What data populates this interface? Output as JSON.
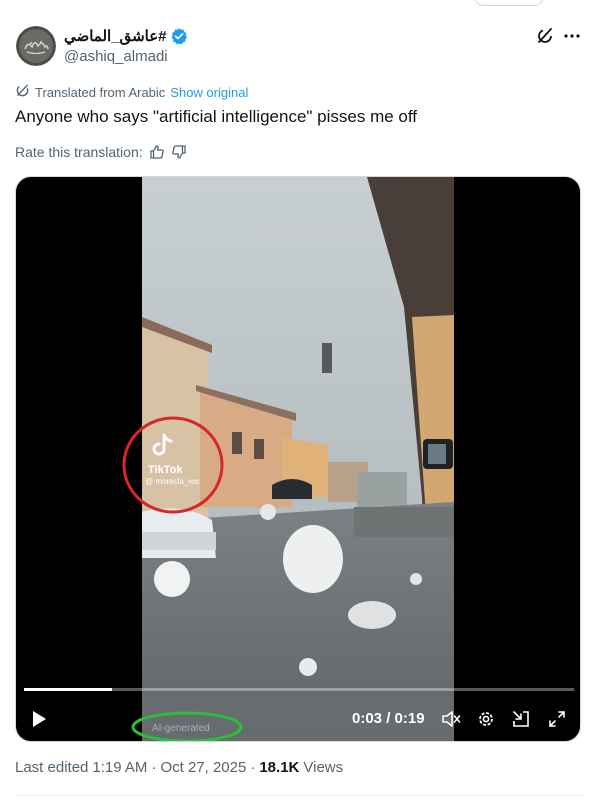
{
  "author": {
    "display_name": "عاشق_الماضي#",
    "handle": "@ashiq_almadi",
    "verified": true
  },
  "translation": {
    "label": "Translated from Arabic",
    "show_original_label": "Show original",
    "rate_label": "Rate this translation:"
  },
  "tweet": {
    "text": "Anyone who says \"artificial intelligence\" pisses me off"
  },
  "video": {
    "current_time": "0:03",
    "duration": "0:19",
    "time_display": "0:03 / 0:19",
    "progress_fraction": 0.16,
    "watermark_brand": "TikTok",
    "watermark_user": "@ morecla_rec",
    "ai_label": "AI-generated",
    "annotations": {
      "watermark_circle_color": "#d62828",
      "ai_label_ellipse_color": "#2bbf3a"
    }
  },
  "meta": {
    "edited_label": "Last edited",
    "time": "1:19 AM",
    "date": "Oct 27, 2025",
    "views_count": "18.1K",
    "views_label": "Views"
  },
  "colors": {
    "accent": "#1d9bf0",
    "secondary_text": "#536471",
    "primary_text": "#0f1419"
  },
  "icons": {
    "grok": "grok-icon",
    "more": "more-icon",
    "translate": "translate-icon",
    "thumbs_up": "thumbs-up-icon",
    "thumbs_down": "thumbs-down-icon",
    "play": "play-icon",
    "mute": "mute-icon",
    "settings": "settings-icon",
    "pip": "picture-in-picture-icon",
    "fullscreen": "fullscreen-icon"
  }
}
